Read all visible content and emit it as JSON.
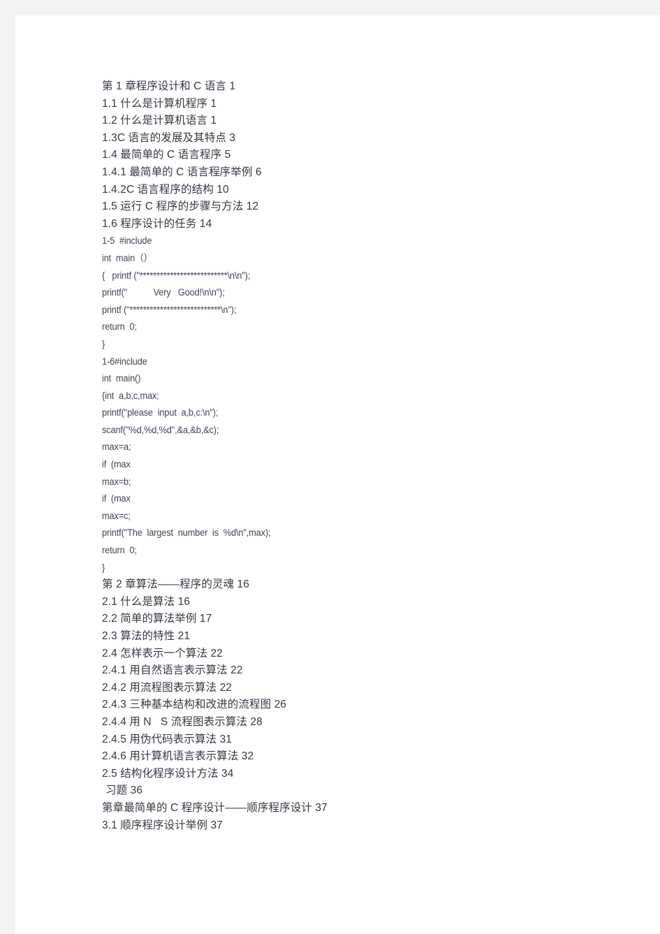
{
  "document": {
    "title": "第 1 章程序设计和 C 语言 1",
    "text_color": "#3b3548",
    "page_background": "#ffffff",
    "backdrop_color": "#f4f4f5",
    "lines": [
      {
        "kind": "toc",
        "text": "第 1 章程序设计和 C 语言 1"
      },
      {
        "kind": "toc",
        "text": "1.1 什么是计算机程序 1"
      },
      {
        "kind": "toc",
        "text": "1.2 什么是计算机语言 1"
      },
      {
        "kind": "toc",
        "text": "1.3C 语言的发展及其特点 3"
      },
      {
        "kind": "toc",
        "text": "1.4 最简单的 C 语言程序 5"
      },
      {
        "kind": "toc",
        "text": "1.4.1 最简单的 C 语言程序举例 6"
      },
      {
        "kind": "toc",
        "text": "1.4.2C 语言程序的结构 10"
      },
      {
        "kind": "toc",
        "text": "1.5 运行 C 程序的步骤与方法 12"
      },
      {
        "kind": "toc",
        "text": "1.6 程序设计的任务 14"
      },
      {
        "kind": "code",
        "text": "1-5  #include"
      },
      {
        "kind": "code",
        "text": "int  main（）"
      },
      {
        "kind": "code",
        "text": "{   printf (\"**************************\\n\\n\");"
      },
      {
        "kind": "code",
        "text": "printf(\"           Very   Good!\\n\\n\");"
      },
      {
        "kind": "code",
        "text": "printf (\"***************************\\n\");"
      },
      {
        "kind": "code",
        "text": "return  0;"
      },
      {
        "kind": "code",
        "text": "}"
      },
      {
        "kind": "code",
        "text": "1-6#include"
      },
      {
        "kind": "code",
        "text": "int  main()"
      },
      {
        "kind": "code",
        "text": "{int  a,b,c,max;"
      },
      {
        "kind": "code",
        "text": "printf(\"please  input  a,b,c:\\n\");"
      },
      {
        "kind": "code",
        "text": "scanf(\"%d,%d,%d\",&a,&b,&c);"
      },
      {
        "kind": "code",
        "text": "max=a;"
      },
      {
        "kind": "code",
        "text": "if  (max"
      },
      {
        "kind": "code",
        "text": "max=b;"
      },
      {
        "kind": "code",
        "text": "if  (max"
      },
      {
        "kind": "code",
        "text": "max=c;"
      },
      {
        "kind": "code",
        "text": "printf(\"The  largest  number  is  %d\\n\",max);"
      },
      {
        "kind": "code",
        "text": "return  0;"
      },
      {
        "kind": "code",
        "text": "}"
      },
      {
        "kind": "toc",
        "text": "第 2 章算法——程序的灵魂 16"
      },
      {
        "kind": "toc",
        "text": "2.1 什么是算法 16"
      },
      {
        "kind": "toc",
        "text": "2.2 简单的算法举例 17"
      },
      {
        "kind": "toc",
        "text": "2.3 算法的特性 21"
      },
      {
        "kind": "toc",
        "text": "2.4 怎样表示一个算法 22"
      },
      {
        "kind": "toc",
        "text": "2.4.1 用自然语言表示算法 22"
      },
      {
        "kind": "toc",
        "text": "2.4.2 用流程图表示算法 22"
      },
      {
        "kind": "toc",
        "text": "2.4.3 三种基本结构和改进的流程图 26"
      },
      {
        "kind": "toc",
        "text": "2.4.4 用 N   S 流程图表示算法 28"
      },
      {
        "kind": "toc",
        "text": "2.4.5 用伪代码表示算法 31"
      },
      {
        "kind": "toc",
        "text": "2.4.6 用计算机语言表示算法 32"
      },
      {
        "kind": "toc",
        "text": "2.5 结构化程序设计方法 34"
      },
      {
        "kind": "toc",
        "text": "习题 36",
        "indent": true
      },
      {
        "kind": "toc",
        "text": "第章最简单的 C 程序设计——顺序程序设计 37"
      },
      {
        "kind": "toc",
        "text": "3.1 顺序程序设计举例 37"
      }
    ]
  }
}
